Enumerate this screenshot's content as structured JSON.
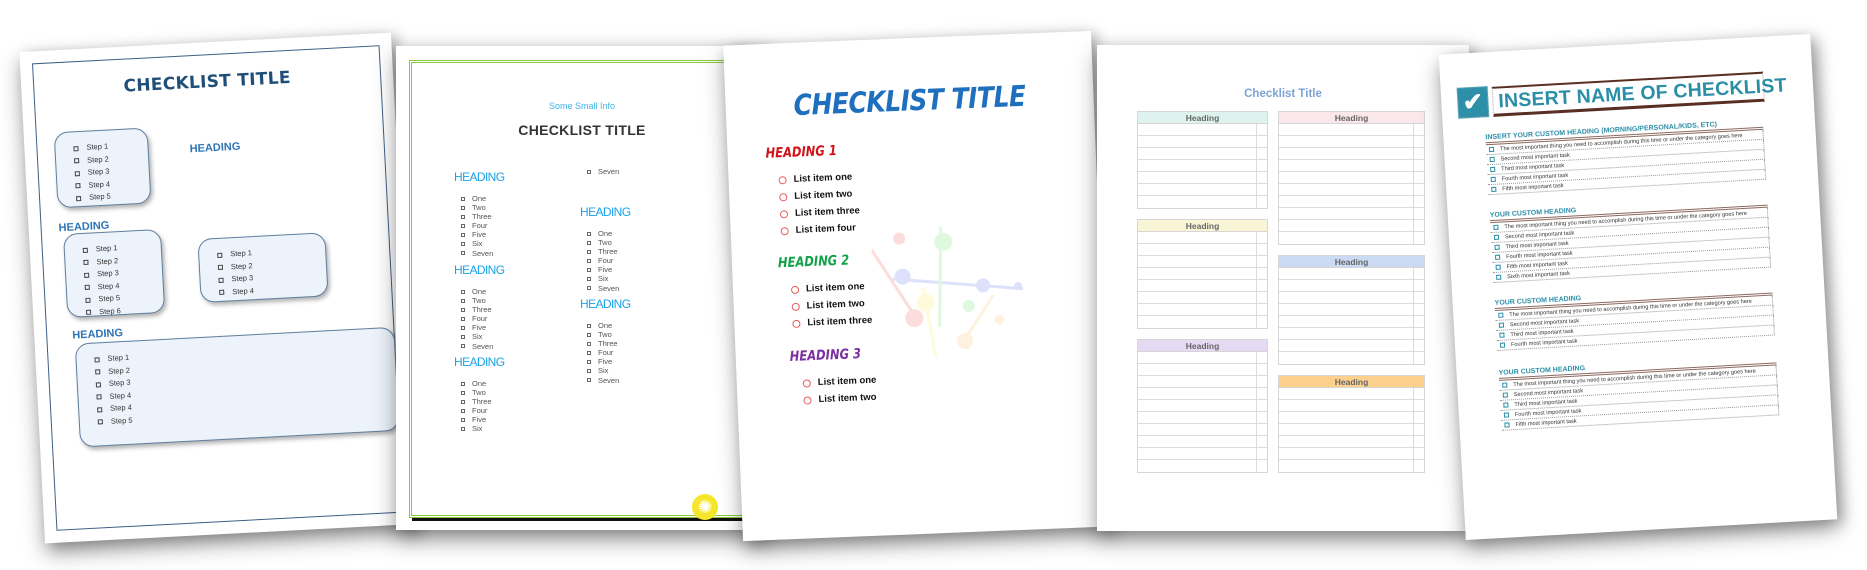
{
  "templates": [
    {
      "title": "CHECKLIST TITLE",
      "headings": [
        "HEADING",
        "HEADING",
        "HEADING"
      ],
      "boxes": [
        [
          "Step 1",
          "Step 2",
          "Step 3",
          "Step 4",
          "Step 5"
        ],
        [
          "Step 1",
          "Step 2",
          "Step 3",
          "Step 4",
          "Step 5",
          "Step 6"
        ],
        [
          "Step 1",
          "Step 2",
          "Step 3",
          "Step 4"
        ],
        [
          "Step 1",
          "Step 2",
          "Step 3",
          "Step 4",
          "Step 4",
          "Step 5"
        ]
      ],
      "colors": {
        "title": "#1f4e79",
        "heading": "#2e75b6",
        "box_fill": "#edf3fb"
      }
    },
    {
      "small_info": "Some Small Info",
      "title": "CHECKLIST TITLE",
      "sections": [
        {
          "heading": "HEADING",
          "items": [
            "One",
            "Two",
            "Three",
            "Four",
            "Five",
            "Six",
            "Seven"
          ]
        },
        {
          "heading": "HEADING",
          "items": [
            "One",
            "Two",
            "Three",
            "Four",
            "Five",
            "Six",
            "Seven"
          ]
        },
        {
          "heading": "HEADING",
          "items": [
            "One",
            "Two",
            "Three",
            "Four",
            "Five",
            "Six"
          ]
        },
        {
          "heading": "",
          "items": [
            "Seven"
          ]
        },
        {
          "heading": "HEADING",
          "items": [
            "One",
            "Two",
            "Three",
            "Four",
            "Five",
            "Six",
            "Seven"
          ]
        },
        {
          "heading": "HEADING",
          "items": [
            "One",
            "Two",
            "Three",
            "Four",
            "Five",
            "Six",
            "Seven"
          ]
        }
      ],
      "decor_icon": "sun-icon",
      "colors": {
        "border": "#8cc63f",
        "heading": "#1aa3e6",
        "small_info": "#3cb4e6"
      }
    },
    {
      "title": "CHECKLIST TITLE",
      "sections": [
        {
          "heading": "HEADING 1",
          "color": "#d0121b",
          "items": [
            "List item one",
            "List item two",
            "List item three",
            "List item four"
          ]
        },
        {
          "heading": "HEADING 2",
          "color": "#12a34a",
          "items": [
            "List item one",
            "List item two",
            "List item three"
          ]
        },
        {
          "heading": "HEADING 3",
          "color": "#7a2ea0",
          "items": [
            "List item one",
            "List item two"
          ]
        }
      ],
      "decor_icon": "paint-splatter-icon",
      "colors": {
        "title": "#1f6fbf",
        "ring": "#e85a5a"
      }
    },
    {
      "title": "Checklist Title",
      "tables": [
        {
          "heading": "Heading",
          "color": "#dff3ee",
          "rows": 7
        },
        {
          "heading": "Heading",
          "color": "#fbe6ea",
          "rows": 10
        },
        {
          "heading": "Heading",
          "color": "#faf5d6",
          "rows": 8
        },
        {
          "heading": "Heading",
          "color": "#c9daf2",
          "rows": 8
        },
        {
          "heading": "Heading",
          "color": "#e6d9f3",
          "rows": 10
        },
        {
          "heading": "Heading",
          "color": "#fdd08e",
          "rows": 7
        }
      ],
      "colors": {
        "title": "#7ca3d4"
      }
    },
    {
      "title": "INSERT NAME OF CHECKLIST",
      "icon": "checkmark-icon",
      "sections": [
        {
          "heading": "INSERT YOUR CUSTOM HEADING (MORNING/PERSONAL/KIDS, ETC)",
          "items": [
            "The most important thing you need to accomplish during this time or under the category goes here",
            "Second most important task",
            "Third most important task",
            "Fourth most important task",
            "Fifth most important task"
          ]
        },
        {
          "heading": "YOUR CUSTOM HEADING",
          "items": [
            "The most important thing you need to accomplish during this time or under the category goes here",
            "Second most important task",
            "Third most important task",
            "Fourth most important task",
            "Fifth most important task",
            "Sixth most important task"
          ]
        },
        {
          "heading": "YOUR CUSTOM HEADING",
          "items": [
            "The most important thing you need to accomplish during this time or under the category goes here",
            "Second most important task",
            "Third most important task",
            "Fourth most important task"
          ]
        },
        {
          "heading": "YOUR CUSTOM HEADING",
          "items": [
            "The most important thing you need to accomplish during this time or under the category goes here",
            "Second most important task",
            "Third most important task",
            "Fourth most important task",
            "Fifth most important task"
          ]
        }
      ],
      "colors": {
        "accent": "#2b8ea7",
        "rule": "#5a2e22"
      }
    }
  ]
}
